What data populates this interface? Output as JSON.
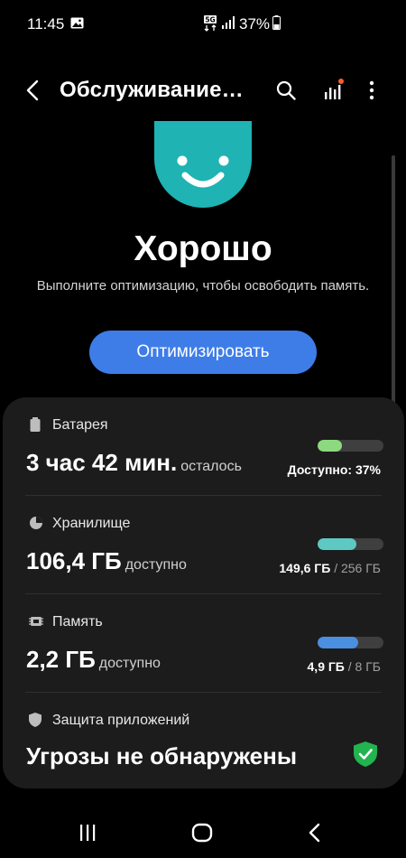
{
  "status_bar": {
    "time": "11:45",
    "network": "5G",
    "battery_percent": "37%",
    "icons": [
      "gallery-icon",
      "network-5g-icon",
      "signal-icon",
      "battery-icon"
    ]
  },
  "app_bar": {
    "title": "Обслуживание…",
    "icons": [
      "back-icon",
      "search-icon",
      "diagnostics-icon",
      "more-options-icon"
    ]
  },
  "hero": {
    "icon": "smiley-face-icon",
    "status": "Хорошо",
    "description": "Выполните оптимизацию, чтобы освободить память.",
    "optimize_button": "Оптимизировать"
  },
  "rows": [
    {
      "icon": "battery-icon",
      "label": "Батарея",
      "value": "3 час 42 мин.",
      "unit": "осталось",
      "level": 0.37,
      "bar_color": "#8dd97f",
      "right_main": "Доступно: 37%",
      "right_sub": ""
    },
    {
      "icon": "storage-icon",
      "label": "Хранилище",
      "value": "106,4 ГБ",
      "unit": "доступно",
      "level": 0.584,
      "bar_color": "#5ec9c2",
      "right_main": "149,6 ГБ",
      "right_sub": " / 256 ГБ"
    },
    {
      "icon": "memory-icon",
      "label": "Память",
      "value": "2,2 ГБ",
      "unit": "доступно",
      "level": 0.6125,
      "bar_color": "#4a8fe0",
      "right_main": "4,9 ГБ",
      "right_sub": " / 8 ГБ"
    },
    {
      "icon": "shield-icon",
      "label": "Защита приложений",
      "value": "Угрозы не обнаружены",
      "status_icon": "shield-check-icon"
    }
  ],
  "nav_bar": {
    "icons": [
      "recent-apps-icon",
      "home-icon",
      "back-icon"
    ]
  },
  "colors": {
    "background": "#000000",
    "card": "#1c1c1c",
    "accent": "#3e7de8",
    "smiley": "#1fb3b3",
    "shield_ok": "#22b44f"
  }
}
